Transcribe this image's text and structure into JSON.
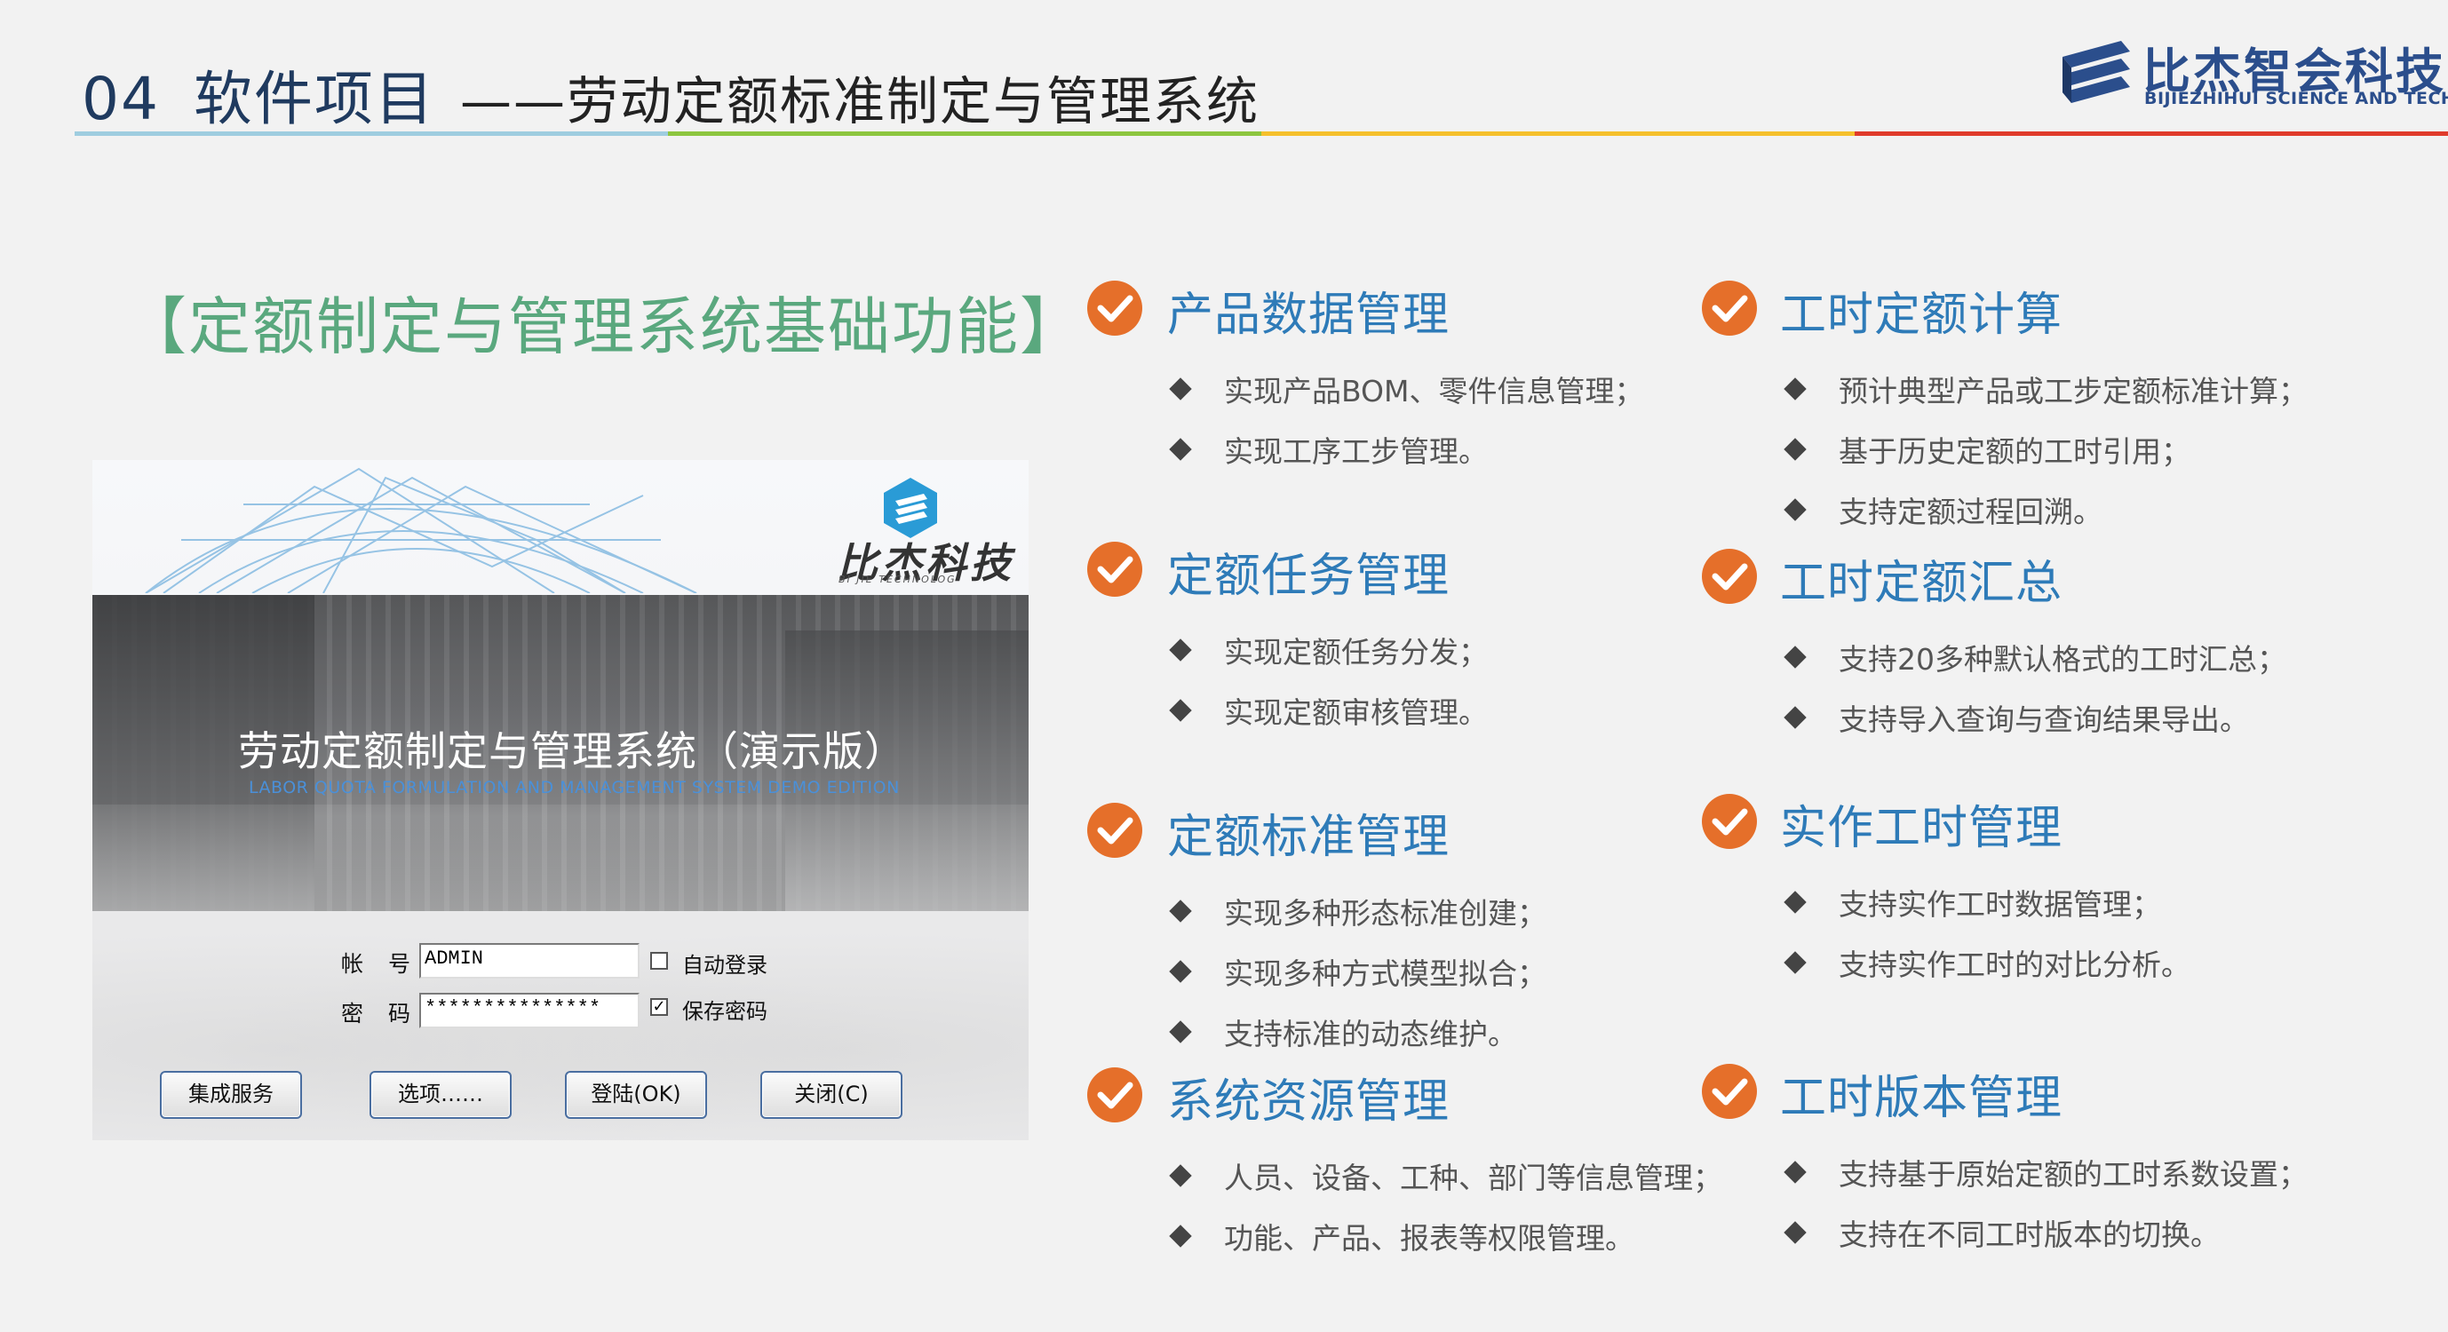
{
  "header": {
    "number": "04",
    "section": "软件项目",
    "subtitle": "——劳动定额标准制定与管理系统",
    "line_colors": [
      "#9fcde0",
      "#8dc63f",
      "#f5c02c",
      "#e03b2b"
    ]
  },
  "brand": {
    "name_cn": "比杰智会科技",
    "name_en": "BIJIEZHIHUI SCIENCE AND TECHNOLOGY",
    "color": "#2b4e8c"
  },
  "left_title": "【定额制定与管理系统基础功能】",
  "login_screen": {
    "logo_cn": "比杰科技",
    "logo_en": "BI JIE TECHNOLOG",
    "system_title_cn": "劳动定额制定与管理系统（演示版）",
    "system_title_en": "LABOR QUOTA FORMULATION AND MANAGEMENT SYSTEM DEMO EDITION",
    "account_label": "帐 号:",
    "account_value": "ADMIN",
    "password_label": "密 码:",
    "password_value": "***************",
    "auto_login_label": "自动登录",
    "auto_login_checked": false,
    "save_password_label": "保存密码",
    "save_password_checked": true,
    "check_mark": "✓",
    "buttons": [
      "集成服务",
      "选项……",
      "登陆(OK)",
      "关闭(C)"
    ]
  },
  "features": [
    {
      "title": "产品数据管理",
      "items": [
        "实现产品BOM、零件信息管理；",
        "实现工序工步管理。"
      ]
    },
    {
      "title": "定额任务管理",
      "items": [
        "实现定额任务分发；",
        "实现定额审核管理。"
      ]
    },
    {
      "title": "定额标准管理",
      "items": [
        "实现多种形态标准创建；",
        "实现多种方式模型拟合；",
        "支持标准的动态维护。"
      ]
    },
    {
      "title": "系统资源管理",
      "items": [
        "人员、设备、工种、部门等信息管理；",
        "功能、产品、报表等权限管理。"
      ]
    },
    {
      "title": "工时定额计算",
      "items": [
        "预计典型产品或工步定额标准计算；",
        "基于历史定额的工时引用；",
        "支持定额过程回溯。"
      ]
    },
    {
      "title": "工时定额汇总",
      "items": [
        "支持20多种默认格式的工时汇总；",
        "支持导入查询与查询结果导出。"
      ]
    },
    {
      "title": "实作工时管理",
      "items": [
        "支持实作工时数据管理；",
        "支持实作工时的对比分析。"
      ]
    },
    {
      "title": "工时版本管理",
      "items": [
        "支持基于原始定额的工时系数设置；",
        "支持在不同工时版本的切换。"
      ]
    }
  ],
  "colors": {
    "accent_orange": "#e56f2a",
    "feature_title_blue": "#2e7bb8",
    "left_title_green": "#5aa87e",
    "header_navy": "#1f3a5f"
  }
}
